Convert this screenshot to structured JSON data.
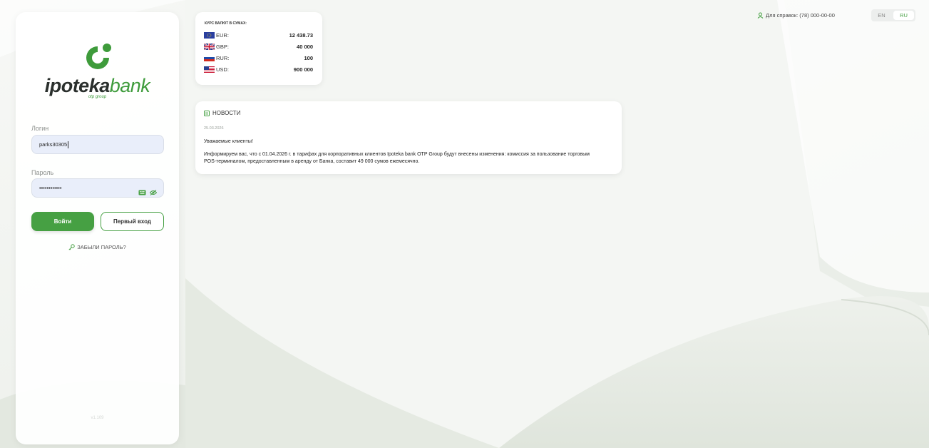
{
  "brand": {
    "name_part1": "ipoteka",
    "name_part2": "bank",
    "sub": "otp group",
    "green": "#46a043",
    "dark": "#2a2f2c"
  },
  "login": {
    "login_label": "Логин",
    "login_value": "parks30305",
    "password_label": "Пароль",
    "password_value": "••••••••••••",
    "login_button": "Войти",
    "first_login_button": "Первый вход",
    "forgot_link": "ЗАБЫЛИ ПАРОЛЬ?",
    "version": "v1.109"
  },
  "rates": {
    "title": "КУРС ВАЛЮТ В СУМАХ:",
    "items": [
      {
        "code": "EUR:",
        "value": "12 438.73",
        "flag": "eu-flag-icon"
      },
      {
        "code": "GBP:",
        "value": "40 000",
        "flag": "uk-flag-icon"
      },
      {
        "code": "RUR:",
        "value": "100",
        "flag": "ru-flag-icon"
      },
      {
        "code": "USD:",
        "value": "900 000",
        "flag": "us-flag-icon"
      }
    ]
  },
  "news": {
    "title": "НОВОСТИ",
    "date": "25.03.2026",
    "greeting": "Уважаемые клиенты!",
    "body": "Информируем вас, что с 01.04.2026 г. в тарифах для корпоративных клиентов Ipoteka bank OTP Group будут внесены изменения: комиссия за пользование торговым POS-терминалом, предоставленным в аренду от Банка, составит 49 000 сумов ежемесячно."
  },
  "header": {
    "contact": "Для справок: (78) 000-00-00",
    "lang_en": "EN",
    "lang_ru": "RU"
  }
}
